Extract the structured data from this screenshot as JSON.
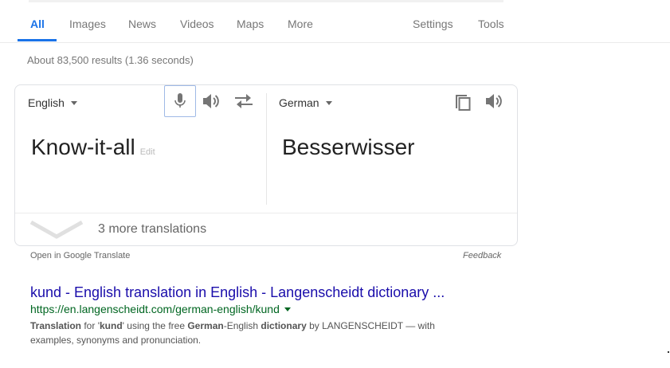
{
  "tabs": {
    "all": "All",
    "images": "Images",
    "news": "News",
    "videos": "Videos",
    "maps": "Maps",
    "more": "More",
    "settings": "Settings",
    "tools": "Tools"
  },
  "result_stats": "About 83,500 results (1.36 seconds)",
  "translate": {
    "source_lang": "English",
    "target_lang": "German",
    "source_text": "Know-it-all",
    "edit_label": "Edit",
    "target_text": "Besserwisser",
    "more_translations": "3 more translations",
    "open_link": "Open in Google Translate",
    "feedback": "Feedback",
    "icons": {
      "mic": "microphone-icon",
      "speaker": "speaker-icon",
      "swap": "swap-arrows-icon",
      "copy": "copy-icon",
      "chevron": "chevron-down-icon"
    }
  },
  "result": {
    "title": "kund - English translation in English - Langenscheidt dictionary ...",
    "url": "https://en.langenscheidt.com/german-english/kund",
    "snippet": {
      "p1": "Translation",
      "p2": " for '",
      "p3": "kund",
      "p4": "' using the free ",
      "p5": "German",
      "p6": "-English ",
      "p7": "dictionary",
      "p8": " by LANGENSCHEIDT — with examples, synonyms and pronunciation."
    }
  },
  "colors": {
    "accent": "#1a73e8",
    "link": "#1a0dab",
    "url": "#006621",
    "muted": "#777777"
  }
}
